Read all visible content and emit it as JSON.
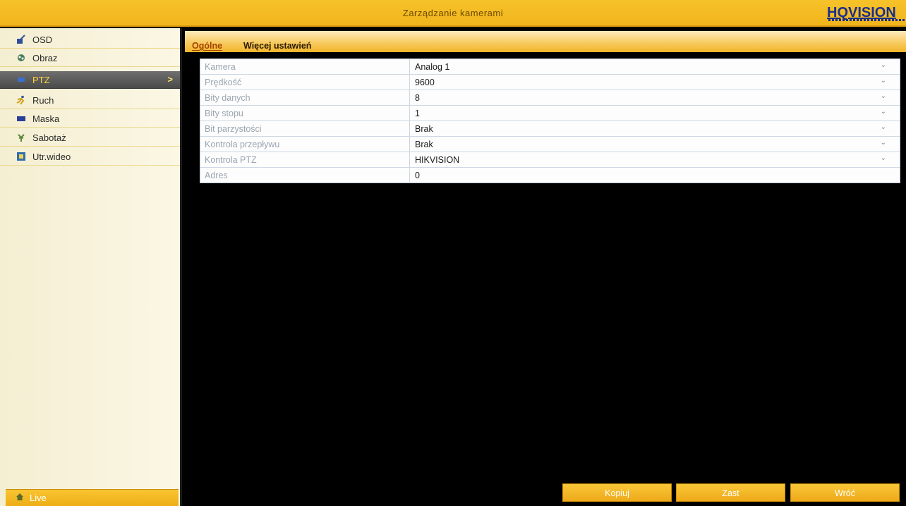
{
  "header": {
    "title": "Zarządzanie kamerami",
    "logo": "HQVISION"
  },
  "sidebar": {
    "items": [
      {
        "label": "OSD",
        "icon": "osd-icon"
      },
      {
        "label": "Obraz",
        "icon": "image-icon"
      },
      {
        "label": "PTZ",
        "icon": "ptz-icon",
        "active": true
      },
      {
        "label": "Ruch",
        "icon": "motion-icon"
      },
      {
        "label": "Maska",
        "icon": "mask-icon"
      },
      {
        "label": "Sabotaż",
        "icon": "tamper-icon"
      },
      {
        "label": "Utr.wideo",
        "icon": "video-loss-icon"
      }
    ],
    "live_label": "Live"
  },
  "tabs": [
    {
      "label": "Ogólne",
      "active": true
    },
    {
      "label": "Więcej ustawień",
      "active": false
    }
  ],
  "settings": [
    {
      "label": "Kamera",
      "value": "Analog 1",
      "dropdown": true
    },
    {
      "label": "Prędkość",
      "value": "9600",
      "dropdown": true
    },
    {
      "label": "Bity danych",
      "value": "8",
      "dropdown": true
    },
    {
      "label": "Bity stopu",
      "value": "1",
      "dropdown": true
    },
    {
      "label": "Bit parzystości",
      "value": "Brak",
      "dropdown": true
    },
    {
      "label": "Kontrola przepływu",
      "value": "Brak",
      "dropdown": true
    },
    {
      "label": "Kontrola PTZ",
      "value": "HIKVISION",
      "dropdown": true
    },
    {
      "label": "Adres",
      "value": "0",
      "dropdown": false
    }
  ],
  "buttons": {
    "copy": "Kopiuj",
    "apply": "Zast",
    "back": "Wróć"
  },
  "colors": {
    "accent": "#f2b51c",
    "active_item": "#4a4a4a",
    "active_text": "#ffd23a"
  }
}
